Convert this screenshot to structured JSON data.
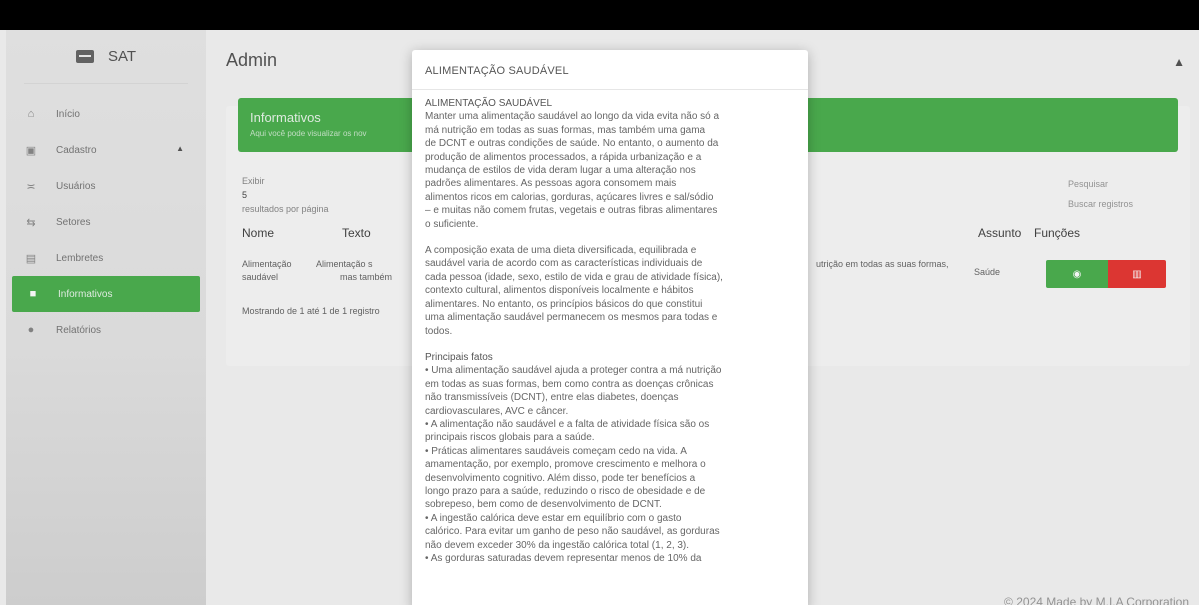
{
  "sidebar": {
    "brand": "SAT",
    "items": [
      {
        "label": "Início",
        "icon": "home-icon"
      },
      {
        "label": "Cadastro",
        "icon": "add-icon"
      },
      {
        "label": "Usuários",
        "icon": "users-icon"
      },
      {
        "label": "Setores",
        "icon": "sectors-icon"
      },
      {
        "label": "Lembretes",
        "icon": "calendar-icon"
      },
      {
        "label": "Informativos",
        "icon": "news-icon"
      },
      {
        "label": "Relatórios",
        "icon": "info-icon"
      }
    ]
  },
  "header": {
    "title": "Admin"
  },
  "card": {
    "title": "Informativos",
    "subtitle": "Aqui você pode visualizar os nov",
    "exibir_label": "Exibir",
    "exibir_value": "5",
    "per_page": "resultados por página",
    "search_label": "Pesquisar",
    "search_placeholder": "Buscar registros",
    "columns": {
      "nome": "Nome",
      "texto": "Texto",
      "assunto": "Assunto",
      "funcoes": "Funções"
    },
    "row": {
      "nome_line1": "Alimentação",
      "nome_line2": "saudável",
      "texto_line1": "Alimentação s",
      "texto_line2": "mas também",
      "texto_tail": "utrição em todas as suas formas,",
      "assunto": "Saúde"
    },
    "showing": "Mostrando de 1 até 1 de 1 registro"
  },
  "footer": "© 2024 Made by M.I.A Corporation",
  "modal": {
    "title": "ALIMENTAÇÃO SAUDÁVEL",
    "p1": [
      "ALIMENTAÇÃO SAUDÁVEL",
      "Manter uma alimentação saudável ao longo da vida evita não só a",
      "má nutrição em todas as suas formas, mas também uma gama",
      "de DCNT e outras condições de saúde. No entanto, o aumento da",
      "produção de alimentos processados, a rápida urbanização e a",
      "mudança de estilos de vida deram lugar a uma alteração nos",
      "padrões alimentares. As pessoas agora consomem mais",
      "alimentos ricos em calorias, gorduras, açúcares livres e sal/sódio",
      "– e muitas não comem frutas, vegetais e outras fibras alimentares",
      "o suficiente."
    ],
    "p2": [
      "A composição exata de uma dieta diversificada, equilibrada e",
      "saudável varia de acordo com as características individuais de",
      "cada pessoa (idade, sexo, estilo de vida e grau de atividade física),",
      "contexto cultural, alimentos disponíveis localmente e hábitos",
      "alimentares. No entanto, os princípios básicos do que constitui",
      "uma alimentação saudável permanecem os mesmos para todas e",
      "todos."
    ],
    "p3": [
      "Principais fatos",
      "• Uma alimentação saudável ajuda a proteger contra a má nutrição",
      "em todas as suas formas, bem como contra as doenças crônicas",
      "não transmissíveis (DCNT), entre elas diabetes, doenças",
      "cardiovasculares, AVC e câncer.",
      "• A alimentação não saudável e a falta de atividade física são os",
      "principais riscos globais para a saúde.",
      "• Práticas alimentares saudáveis começam cedo na vida. A",
      "amamentação, por exemplo, promove crescimento e melhora o",
      "desenvolvimento cognitivo. Além disso, pode ter benefícios a",
      "longo prazo para a saúde, reduzindo o risco de obesidade e de",
      "sobrepeso, bem como de desenvolvimento de DCNT.",
      "• A ingestão calórica deve estar em equilíbrio com o gasto",
      "calórico. Para evitar um ganho de peso não saudável, as gorduras",
      "não devem exceder 30% da ingestão calórica total (1, 2, 3).",
      "• As gorduras saturadas devem representar menos de 10% da"
    ]
  },
  "colors": {
    "green": "#4caf50",
    "red": "#e53935"
  }
}
